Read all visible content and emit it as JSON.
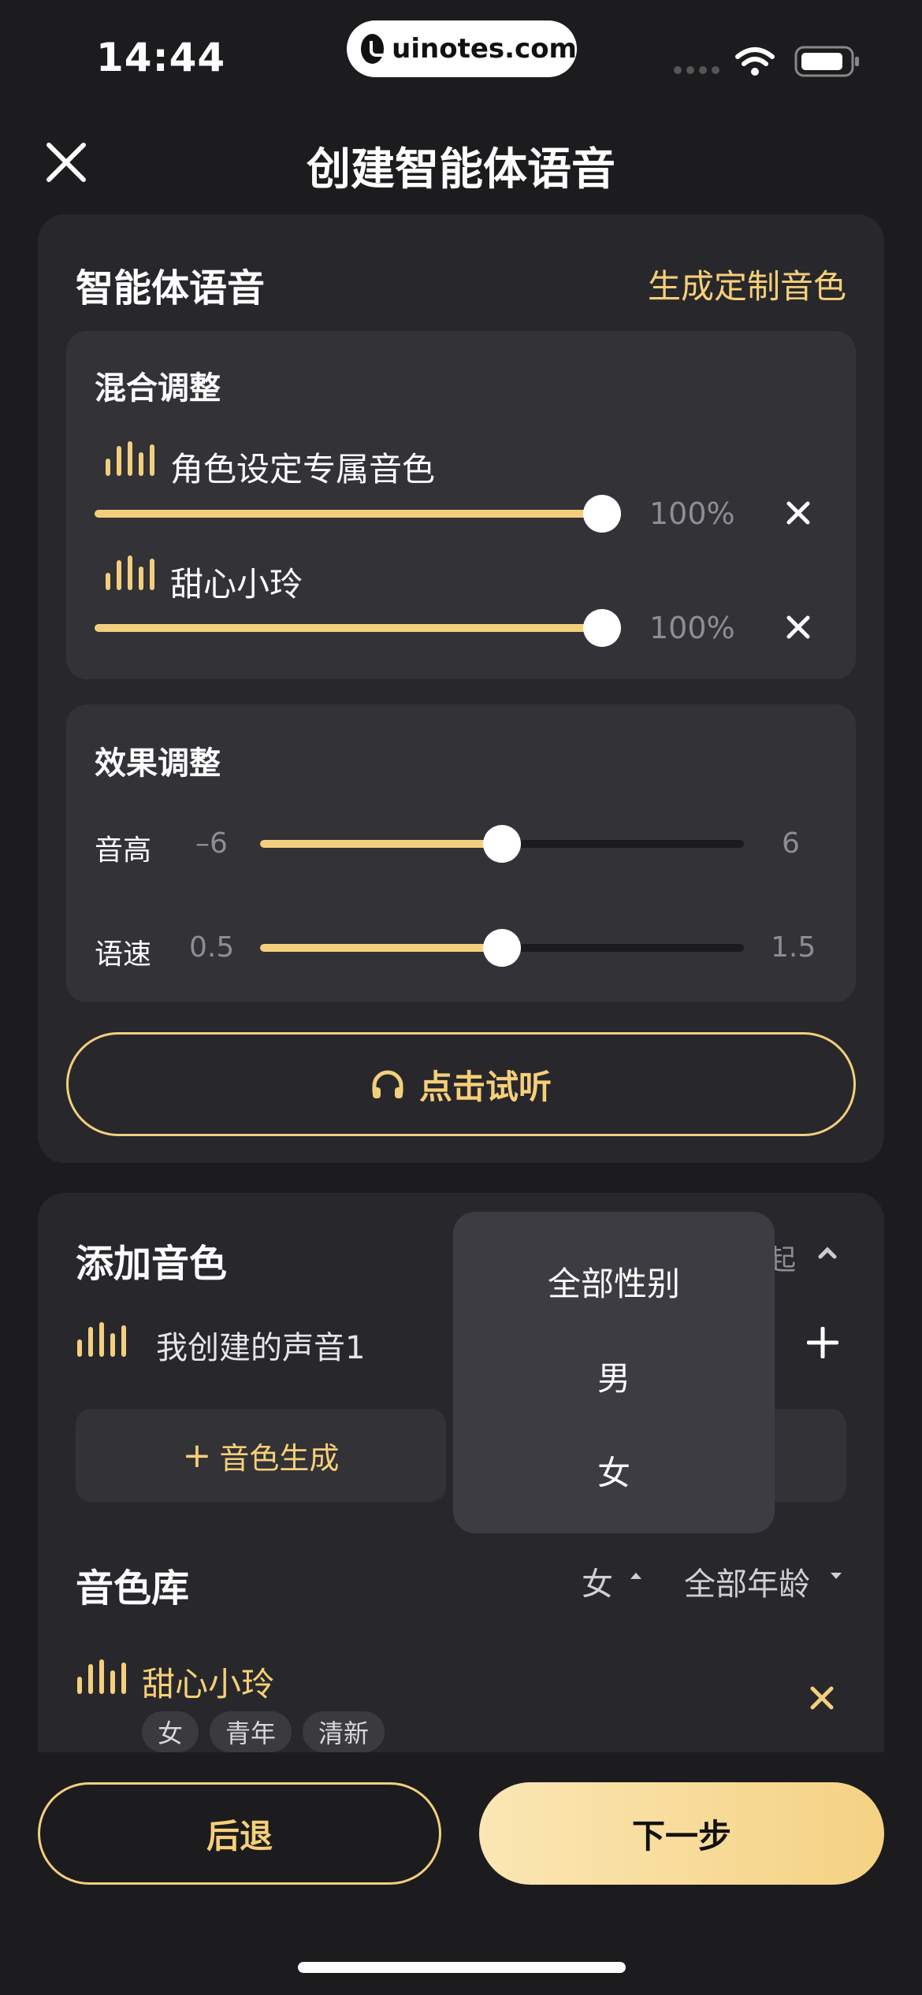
{
  "status_bar": {
    "time": "14:44",
    "url": "uinotes.com"
  },
  "header": {
    "title": "创建智能体语音"
  },
  "voice_card": {
    "title": "智能体语音",
    "custom_link": "生成定制音色",
    "mix": {
      "title": "混合调整",
      "items": [
        {
          "name": "角色设定专属音色",
          "percent_label": "100%",
          "value": 1.0
        },
        {
          "name": "甜心小玲",
          "percent_label": "100%",
          "value": 1.0
        }
      ]
    },
    "effects": {
      "title": "效果调整",
      "pitch": {
        "label": "音高",
        "min": "–6",
        "max": "6",
        "value": 0
      },
      "speed": {
        "label": "语速",
        "min": "0.5",
        "max": "1.5",
        "value": 1.0
      }
    },
    "preview_button": "点击试听"
  },
  "add_card": {
    "title": "添加音色",
    "collapse_label": "收起",
    "my_voice": "我创建的声音1",
    "generate_button": "音色生成",
    "library": {
      "title": "音色库",
      "gender_filter": "女",
      "age_filter": "全部年龄",
      "items": [
        {
          "name": "甜心小玲",
          "tags": [
            "女",
            "青年",
            "清新"
          ]
        }
      ]
    }
  },
  "dropdown": {
    "options": [
      "全部性别",
      "男",
      "女"
    ]
  },
  "footer": {
    "back": "后退",
    "next": "下一步"
  },
  "colors": {
    "accent": "#f3cf7d",
    "background": "#1c1c1f",
    "card": "#28282c"
  }
}
